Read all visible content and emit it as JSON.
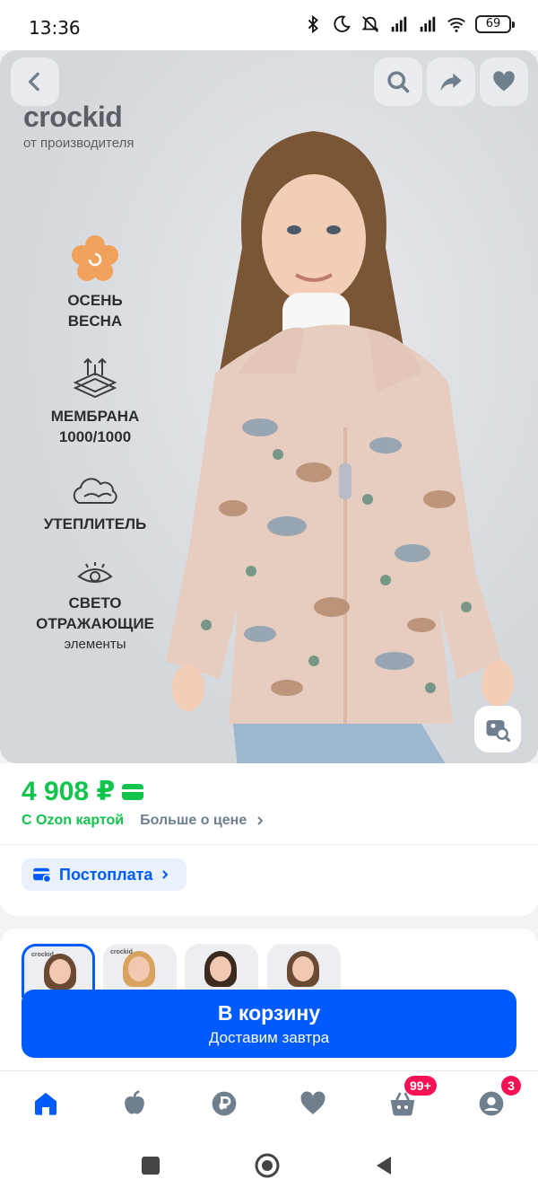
{
  "status_bar": {
    "time": "13:36",
    "battery": "69"
  },
  "brand": {
    "name": "crockid",
    "tagline": "от производителя"
  },
  "features": [
    {
      "line1": "ОСЕНЬ",
      "line2": "ВЕСНА",
      "line3": ""
    },
    {
      "line1": "МЕМБРАНА",
      "line2": "1000/1000",
      "line3": ""
    },
    {
      "line1": "УТЕПЛИТЕЛЬ",
      "line2": "",
      "line3": ""
    },
    {
      "line1": "СВЕТО",
      "line2": "ОТРАЖАЮЩИЕ",
      "line3": "элементы"
    }
  ],
  "price": {
    "value": "4 908 ₽",
    "ozon_card": "С Ozon картой",
    "more": "Больше о цене"
  },
  "postpay": {
    "label": "Постоплата"
  },
  "variants": {
    "thumb_caption": "crockid"
  },
  "cart_button": {
    "label": "В корзину",
    "sub": "Доставим завтра"
  },
  "bottom_nav": {
    "cart_badge": "99+",
    "profile_badge": "3"
  },
  "colors": {
    "accent": "#005bff",
    "price_green": "#10c44c",
    "badge": "#f91155"
  }
}
